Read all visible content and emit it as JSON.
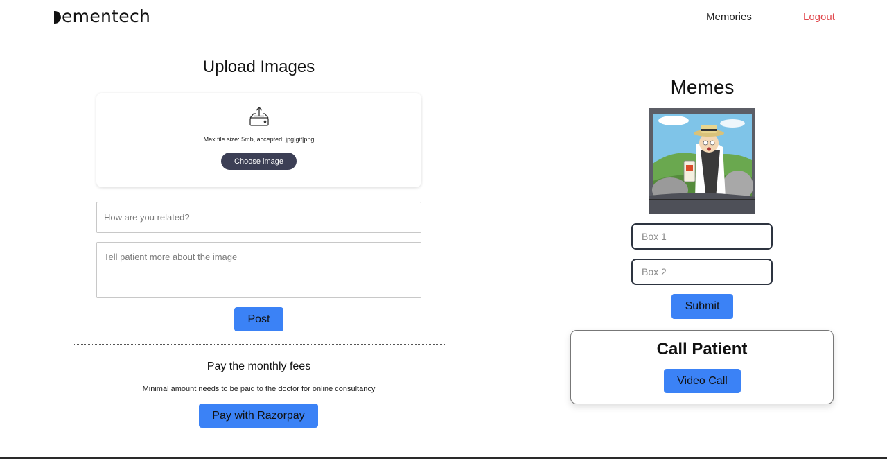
{
  "nav": {
    "brand": "DemenTech",
    "brand_rest": "ementech",
    "links": [
      {
        "label": "Memories"
      },
      {
        "label": "Logout",
        "color": "#e0474c"
      }
    ]
  },
  "upload": {
    "title": "Upload Images",
    "icon": "upload-tray-icon",
    "note": "Max file size: 5mb, accepted: jpg|gif|png",
    "choose_label": "Choose image",
    "related_placeholder": "How are you related?",
    "about_placeholder": "Tell patient more about the image",
    "post_label": "Post"
  },
  "fees": {
    "title": "Pay the monthly fees",
    "subtitle": "Minimal amount needs to be paid to the doctor for online consultancy",
    "pay_label": "Pay with Razorpay"
  },
  "memes": {
    "title": "Memes",
    "image": "meme-template-image",
    "box1_placeholder": "Box 1",
    "box2_placeholder": "Box 2",
    "submit_label": "Submit"
  },
  "call": {
    "title": "Call Patient",
    "video_label": "Video Call"
  },
  "colors": {
    "accent": "#3b82f6",
    "dark_button": "#3c3f55",
    "logout": "#e0474c"
  }
}
